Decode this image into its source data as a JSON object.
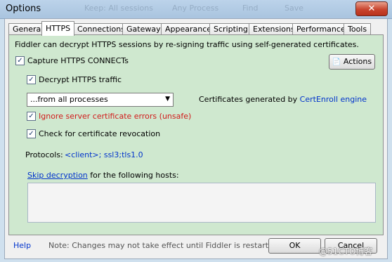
{
  "window": {
    "title": "Options",
    "ghost_items": [
      "Keep: All sessions",
      "Any Process",
      "Find",
      "Save"
    ]
  },
  "tabs": [
    "General",
    "HTTPS",
    "Connections",
    "Gateway",
    "Appearance",
    "Scripting",
    "Extensions",
    "Performance",
    "Tools"
  ],
  "active_tab": "HTTPS",
  "https": {
    "description": "Fiddler can decrypt HTTPS sessions by re-signing traffic using self-generated certificates.",
    "capture_label": "Capture HTTPS CONNECTs",
    "capture_checked": true,
    "actions_label": "Actions",
    "decrypt_label": "Decrypt HTTPS traffic",
    "decrypt_checked": true,
    "process_selected": "...from all processes",
    "cert_prefix": "Certificates generated by",
    "cert_link": "CertEnroll engine",
    "ignore_label": "Ignore server certificate errors (unsafe)",
    "ignore_checked": true,
    "revocation_label": "Check for certificate revocation",
    "revocation_checked": true,
    "protocols_label": "Protocols:",
    "protocols_value": "<client>; ssl3;tls1.0",
    "skip_link": "Skip decryption",
    "skip_suffix": "for the following hosts:"
  },
  "footer": {
    "help": "Help",
    "note": "Note: Changes may not take effect until Fiddler is restarted.",
    "ok": "OK",
    "cancel": "Cancel",
    "watermark": "@51CTO博客"
  }
}
